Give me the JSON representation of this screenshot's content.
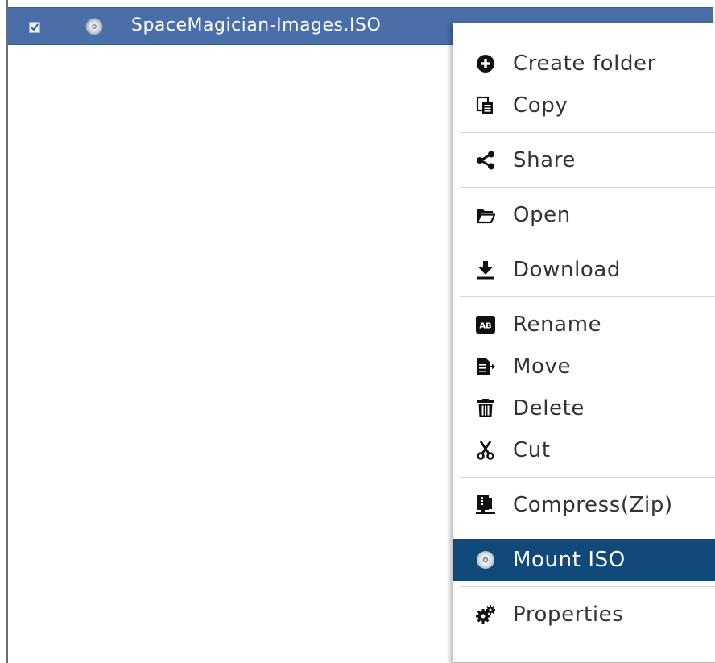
{
  "file_row": {
    "checked": true,
    "icon": "disc-icon",
    "name": "SpaceMagician-Images.ISO"
  },
  "menu": {
    "items": [
      {
        "label": "Create folder",
        "icon": "plus-circle-icon"
      },
      {
        "label": "Copy",
        "icon": "copy-icon"
      },
      {
        "label": "Share",
        "icon": "share-icon"
      },
      {
        "label": "Open",
        "icon": "folder-open-icon"
      },
      {
        "label": "Download",
        "icon": "download-icon"
      },
      {
        "label": "Rename",
        "icon": "rename-icon"
      },
      {
        "label": "Move",
        "icon": "move-icon"
      },
      {
        "label": "Delete",
        "icon": "trash-icon"
      },
      {
        "label": "Cut",
        "icon": "scissors-icon"
      },
      {
        "label": "Compress(Zip)",
        "icon": "compress-icon"
      },
      {
        "label": "Mount ISO",
        "icon": "disc-icon",
        "highlighted": true
      },
      {
        "label": "Properties",
        "icon": "gears-icon"
      }
    ]
  },
  "colors": {
    "selection_row": "#4a6ea8",
    "menu_highlight": "#114a7a",
    "menu_text": "#333333"
  }
}
